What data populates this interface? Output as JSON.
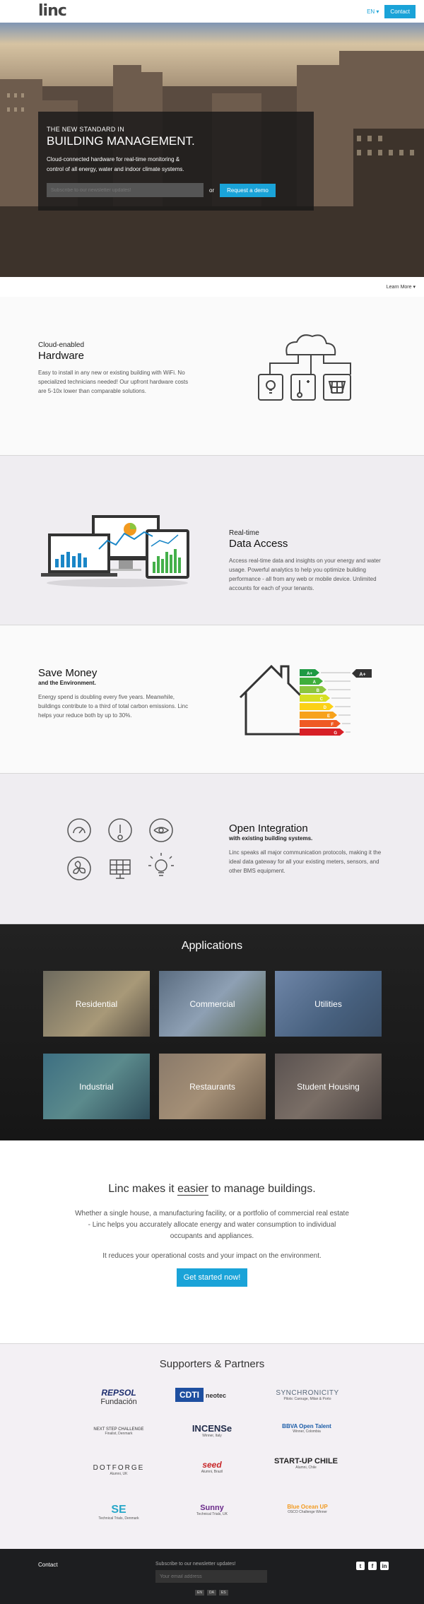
{
  "nav": {
    "logo": "linc",
    "lang": "EN ▾",
    "contact": "Contact"
  },
  "hero": {
    "kicker": "THE NEW STANDARD IN",
    "title": "BUILDING MANAGEMENT.",
    "subtitle": "Cloud-connected hardware for real-time monitoring & control of all energy, water and indoor climate systems.",
    "newsletter_placeholder": "Subscribe to our newsletter updates!",
    "or": "or",
    "demo": "Request a demo"
  },
  "learn_more": "Learn More ▾",
  "features": [
    {
      "kicker": "Cloud-enabled",
      "title": "Hardware",
      "sub": "",
      "body": "Easy to install in any new or existing building with WiFi. No specialized technicians needed! Our upfront hardware costs are 5-10x lower than comparable solutions."
    },
    {
      "kicker": "Real-time",
      "title": "Data Access",
      "sub": "",
      "body": "Access real-time data and insights on your energy and water usage. Powerful analytics to help you optimize building performance - all from any web or mobile device. Unlimited accounts for each of your tenants."
    },
    {
      "kicker": "",
      "title": "Save Money",
      "sub": "and the Environment.",
      "body": "Energy spend is doubling every five years. Meanwhile, buildings contribute to a third of total carbon emissions. Linc helps your reduce both by up to 30%."
    },
    {
      "kicker": "",
      "title": "Open Integration",
      "sub": "with existing building systems.",
      "body": "Linc speaks all major communication protocols, making it the ideal data gateway for all your existing meters, sensors, and other BMS equipment."
    }
  ],
  "energy_labels": [
    "A+",
    "A",
    "B",
    "C",
    "D",
    "E",
    "F",
    "G"
  ],
  "energy_badge": "A+",
  "applications": {
    "title": "Applications",
    "tiles": [
      "Residential",
      "Commercial",
      "Utilities",
      "Industrial",
      "Restaurants",
      "Student Housing"
    ]
  },
  "cta": {
    "title_pre": "Linc makes it ",
    "title_em": "easier",
    "title_post": " to manage buildings.",
    "p1": "Whether a single house, a manufacturing facility, or a portfolio of commercial real estate - Linc helps you accurately allocate energy and water consumption to individual occupants and appliances.",
    "p2": "It reduces your operational costs and your impact on the environment.",
    "button": "Get started now!"
  },
  "partners": {
    "title": "Supporters & Partners",
    "logos": [
      {
        "name": "REPSOL",
        "sub": "Fundación",
        "cap": ""
      },
      {
        "name": "CDTI",
        "sub": "neotec",
        "cap": ""
      },
      {
        "name": "SYNCHRONICITY",
        "sub": "",
        "cap": "Pilots: Carouge, Milan & Porto"
      },
      {
        "name": "NEXT STEP CHALLENGE",
        "sub": "",
        "cap": "Finalist, Denmark"
      },
      {
        "name": "INCENSe",
        "sub": "",
        "cap": "Winner, Italy"
      },
      {
        "name": "BBVA Open Talent",
        "sub": "",
        "cap": "Winner, Colombia"
      },
      {
        "name": "DOTFORGE",
        "sub": "",
        "cap": "Alumni, UK"
      },
      {
        "name": "seed",
        "sub": "",
        "cap": "Alumni, Brazil"
      },
      {
        "name": "START-UP CHILE",
        "sub": "",
        "cap": "Alumni, Chile"
      },
      {
        "name": "SE",
        "sub": "",
        "cap": "Technical Trials, Denmark"
      },
      {
        "name": "Sunny",
        "sub": "",
        "cap": "Technical Trials, UK"
      },
      {
        "name": "Blue Ocean UP",
        "sub": "",
        "cap": "OSCO Challenge Winner"
      }
    ]
  },
  "footer": {
    "contact": "Contact",
    "newsletter": "Subscribe to our newsletter updates!",
    "email_placeholder": "Your email address",
    "langs": [
      "EN",
      "DA",
      "ES"
    ],
    "social": [
      "t",
      "f",
      "in"
    ]
  },
  "colors": {
    "accent": "#1aa3d8"
  }
}
